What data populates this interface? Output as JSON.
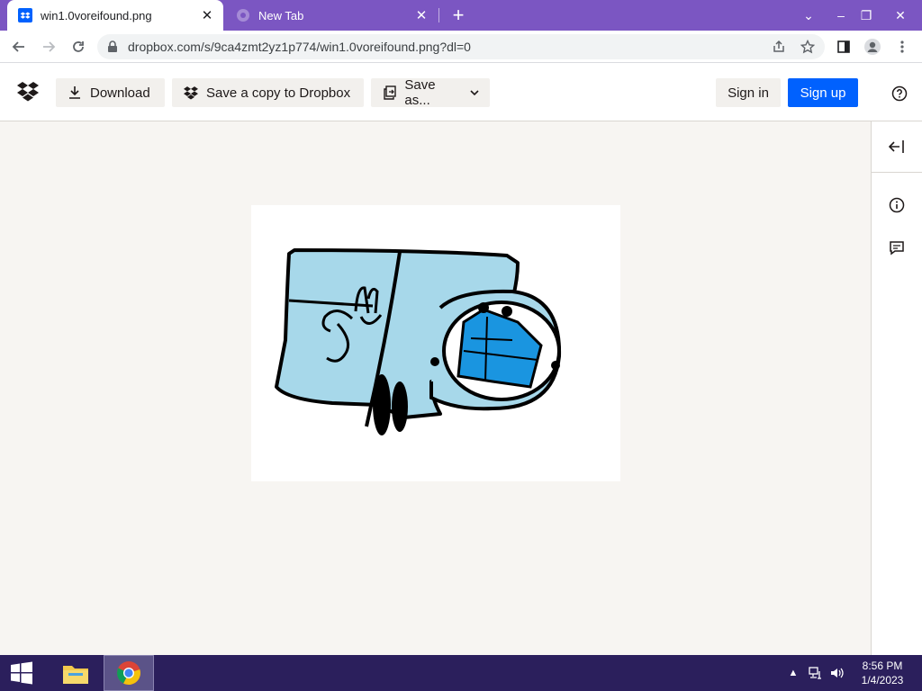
{
  "browser": {
    "tabs": [
      {
        "title": "win1.0voreifound.png",
        "favicon": "dropbox-icon"
      },
      {
        "title": "New Tab",
        "favicon": "chrome-icon"
      }
    ],
    "url": "dropbox.com/s/9ca4zmt2yz1p774/win1.0voreifound.png?dl=0",
    "accent": "#7b56c2"
  },
  "dropbox": {
    "download_label": "Download",
    "save_copy_label": "Save a copy to Dropbox",
    "save_as_label": "Save as...",
    "sign_in_label": "Sign in",
    "sign_up_label": "Sign up",
    "brand_color": "#0061fe"
  },
  "preview": {
    "image_name": "win1.0voreifound.png"
  },
  "taskbar": {
    "time": "8:56 PM",
    "date": "1/4/2023"
  }
}
